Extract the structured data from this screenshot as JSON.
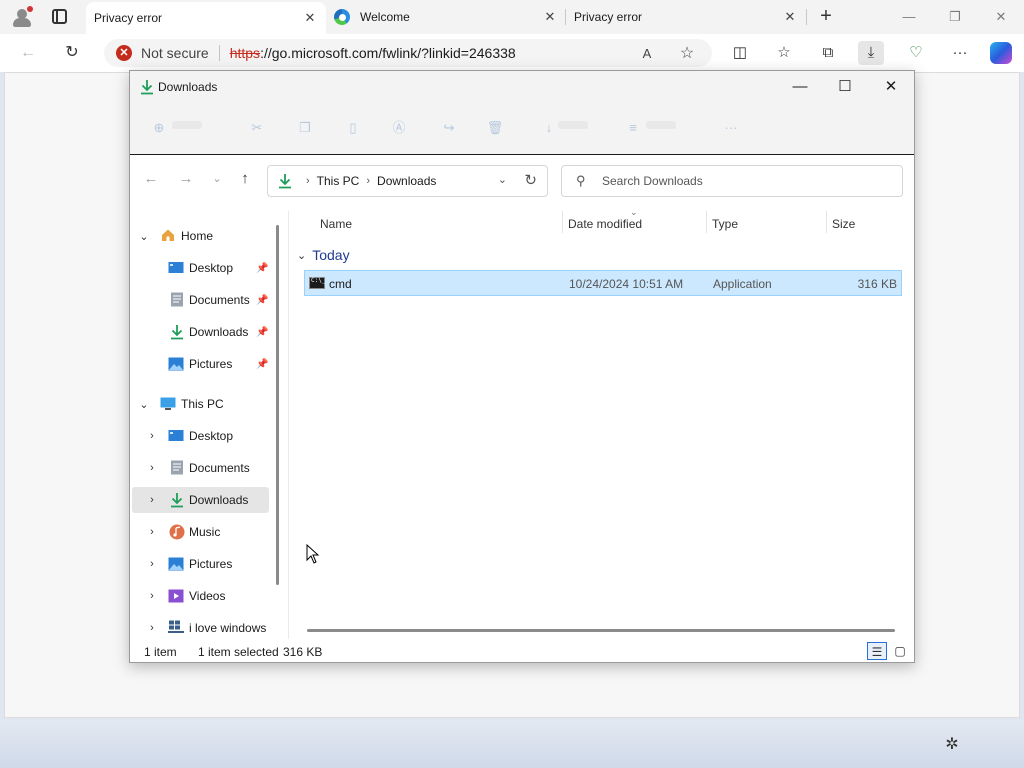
{
  "browser": {
    "tabs": [
      {
        "title": "Privacy error",
        "close": "✕",
        "active": true
      },
      {
        "title": "Welcome",
        "close": "✕",
        "active": false
      },
      {
        "title": "Privacy error",
        "close": "✕",
        "active": false
      }
    ],
    "new_tab": "+",
    "window_controls": {
      "minimize": "—",
      "restore": "❐",
      "close": "✕"
    },
    "address": {
      "security_label": "Not secure",
      "url_protocol": "https",
      "url_rest": "://go.microsoft.com/fwlink/?linkid=246338"
    },
    "icons": {
      "back": "←",
      "refresh": "↻",
      "read_aloud": "A",
      "favorite": "☆",
      "split": "◫",
      "favorites": "☆",
      "collections": "⧉",
      "downloads": "⤓",
      "health": "♡",
      "menu": "···"
    }
  },
  "explorer": {
    "title": "Downloads",
    "window_controls": {
      "minimize": "—",
      "maximize": "☐",
      "close": "✕"
    },
    "breadcrumb": [
      "This PC",
      "Downloads"
    ],
    "search_placeholder": "Search Downloads",
    "sidebar": {
      "home": {
        "label": "Home"
      },
      "quick_access": [
        {
          "label": "Desktop",
          "icon": "desktop-icon",
          "color": "#2b7fd4"
        },
        {
          "label": "Documents",
          "icon": "documents-icon",
          "color": "#9aa4b0"
        },
        {
          "label": "Downloads",
          "icon": "downloads-icon",
          "color": "#1e9e5a"
        },
        {
          "label": "Pictures",
          "icon": "pictures-icon",
          "color": "#2b7fd4"
        }
      ],
      "this_pc": {
        "label": "This PC"
      },
      "this_pc_items": [
        {
          "label": "Desktop",
          "icon": "desktop-icon",
          "color": "#2b7fd4"
        },
        {
          "label": "Documents",
          "icon": "documents-icon",
          "color": "#9aa4b0"
        },
        {
          "label": "Downloads",
          "icon": "downloads-icon",
          "color": "#1e9e5a",
          "selected": true
        },
        {
          "label": "Music",
          "icon": "music-icon",
          "color": "#e0704a"
        },
        {
          "label": "Pictures",
          "icon": "pictures-icon",
          "color": "#2b7fd4"
        },
        {
          "label": "Videos",
          "icon": "videos-icon",
          "color": "#8a4fd0"
        },
        {
          "label": "i love windows",
          "icon": "network-drive-icon",
          "color": "#3b5f8a"
        }
      ]
    },
    "columns": {
      "name": "Name",
      "date": "Date modified",
      "type": "Type",
      "size": "Size"
    },
    "group": "Today",
    "files": [
      {
        "name": "cmd",
        "date": "10/24/2024 10:51 AM",
        "type": "Application",
        "size": "316 KB"
      }
    ],
    "status": {
      "count": "1 item",
      "selection": "1 item selected",
      "size": "316 KB"
    }
  }
}
